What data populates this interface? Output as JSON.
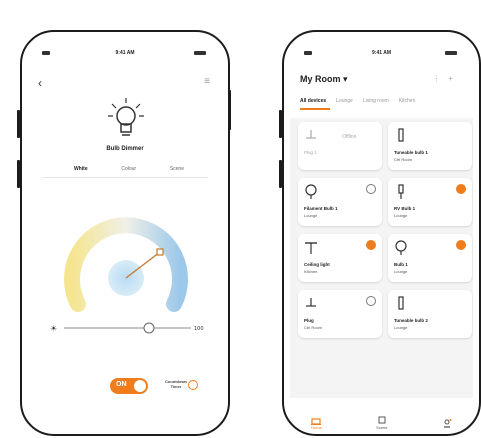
{
  "left_phone": {
    "status_bar": {
      "time": "9:41 AM"
    },
    "header": {
      "back_icon": "chevron-left-icon",
      "menu_icon": "menu-icon"
    },
    "device_title": "Bulb Dimmer",
    "tabs": [
      {
        "label": "White",
        "active": true
      },
      {
        "label": "Colour",
        "active": false
      },
      {
        "label": "Scene",
        "active": false
      }
    ],
    "dial": {
      "warm_color": "#f5e58f",
      "cool_color": "#9cc8ea"
    },
    "brightness": {
      "min_label": "☀",
      "max_label": "100",
      "value": 0.67
    },
    "power_toggle": {
      "label": "ON",
      "state": true,
      "color": "#f07d1d"
    },
    "timer": {
      "label": "Countdown Timer",
      "icon": "timer-icon"
    }
  },
  "right_phone": {
    "status_bar": {
      "time": "9:41 AM"
    },
    "room_title": "My Room ▾",
    "header_icons": [
      "edit-icon",
      "add-icon"
    ],
    "tabs": [
      {
        "label": "All devices",
        "active": true
      },
      {
        "label": "Lounge",
        "active": false
      },
      {
        "label": "Living room",
        "active": false
      },
      {
        "label": "Kitchen",
        "active": false
      }
    ],
    "devices": [
      {
        "name": "Plug 1",
        "room": "",
        "status": "Offline",
        "icon": "plug-icon",
        "power": null
      },
      {
        "name": "Tuneable bulb 1",
        "room": "Ctrl Room",
        "status": "",
        "icon": "tube-icon",
        "power": null
      },
      {
        "name": "Filament Bulb 1",
        "room": "Lounge",
        "status": "",
        "icon": "bulb-icon",
        "power": "off"
      },
      {
        "name": "RV Bulb 1",
        "room": "Lounge",
        "status": "",
        "icon": "lamp-icon",
        "power": "on"
      },
      {
        "name": "Ceiling light",
        "room": "Kitchen",
        "status": "",
        "icon": "ceiling-light-icon",
        "power": "on"
      },
      {
        "name": "Bulb 1",
        "room": "Lounge",
        "status": "",
        "icon": "bulb-icon",
        "power": "on"
      },
      {
        "name": "Plug",
        "room": "Ctrl Room",
        "status": "",
        "icon": "plug-icon",
        "power": "off"
      },
      {
        "name": "Tuneable bulb 2",
        "room": "Lounge",
        "status": "",
        "icon": "tube-icon",
        "power": null
      }
    ],
    "bottom_nav": [
      {
        "label": "Home",
        "icon": "home-icon",
        "active": true
      },
      {
        "label": "Scene",
        "icon": "scene-icon",
        "active": false
      },
      {
        "label": "",
        "icon": "profile-icon",
        "active": false
      }
    ]
  },
  "colors": {
    "accent": "#f07d1d",
    "frame": "#1c1c1c"
  }
}
